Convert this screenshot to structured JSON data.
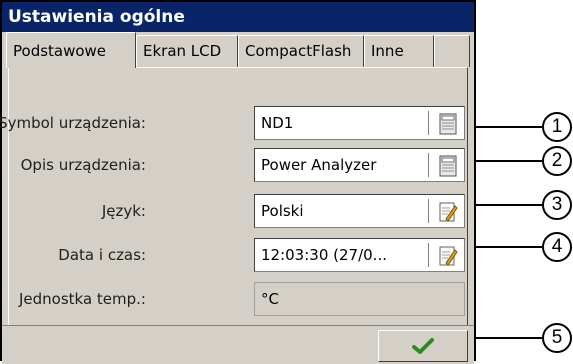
{
  "window": {
    "title": "Ustawienia ogólne"
  },
  "tabs": [
    {
      "label": "Podstawowe",
      "active": true
    },
    {
      "label": "Ekran LCD",
      "active": false
    },
    {
      "label": "CompactFlash",
      "active": false
    },
    {
      "label": "Inne",
      "active": false
    }
  ],
  "form": {
    "device_symbol": {
      "label": "Symbol urządzenia:",
      "value": "ND1",
      "icon": "keypad-icon"
    },
    "device_description": {
      "label": "Opis urządzenia:",
      "value": "Power Analyzer",
      "icon": "keypad-icon"
    },
    "language": {
      "label": "Język:",
      "value": "Polski",
      "icon": "edit-icon"
    },
    "datetime": {
      "label": "Data i czas:",
      "value": "12:03:30 (27/0...",
      "icon": "edit-icon"
    },
    "temp_unit": {
      "label": "Jednostka temp.:",
      "value": "°C"
    }
  },
  "ok_button": {
    "icon": "checkmark-icon"
  },
  "callouts": [
    "1",
    "2",
    "3",
    "4",
    "5"
  ],
  "colors": {
    "titlebar": "#0a246a",
    "window_bg": "#d4d0c8",
    "check": "#2e8b22"
  }
}
